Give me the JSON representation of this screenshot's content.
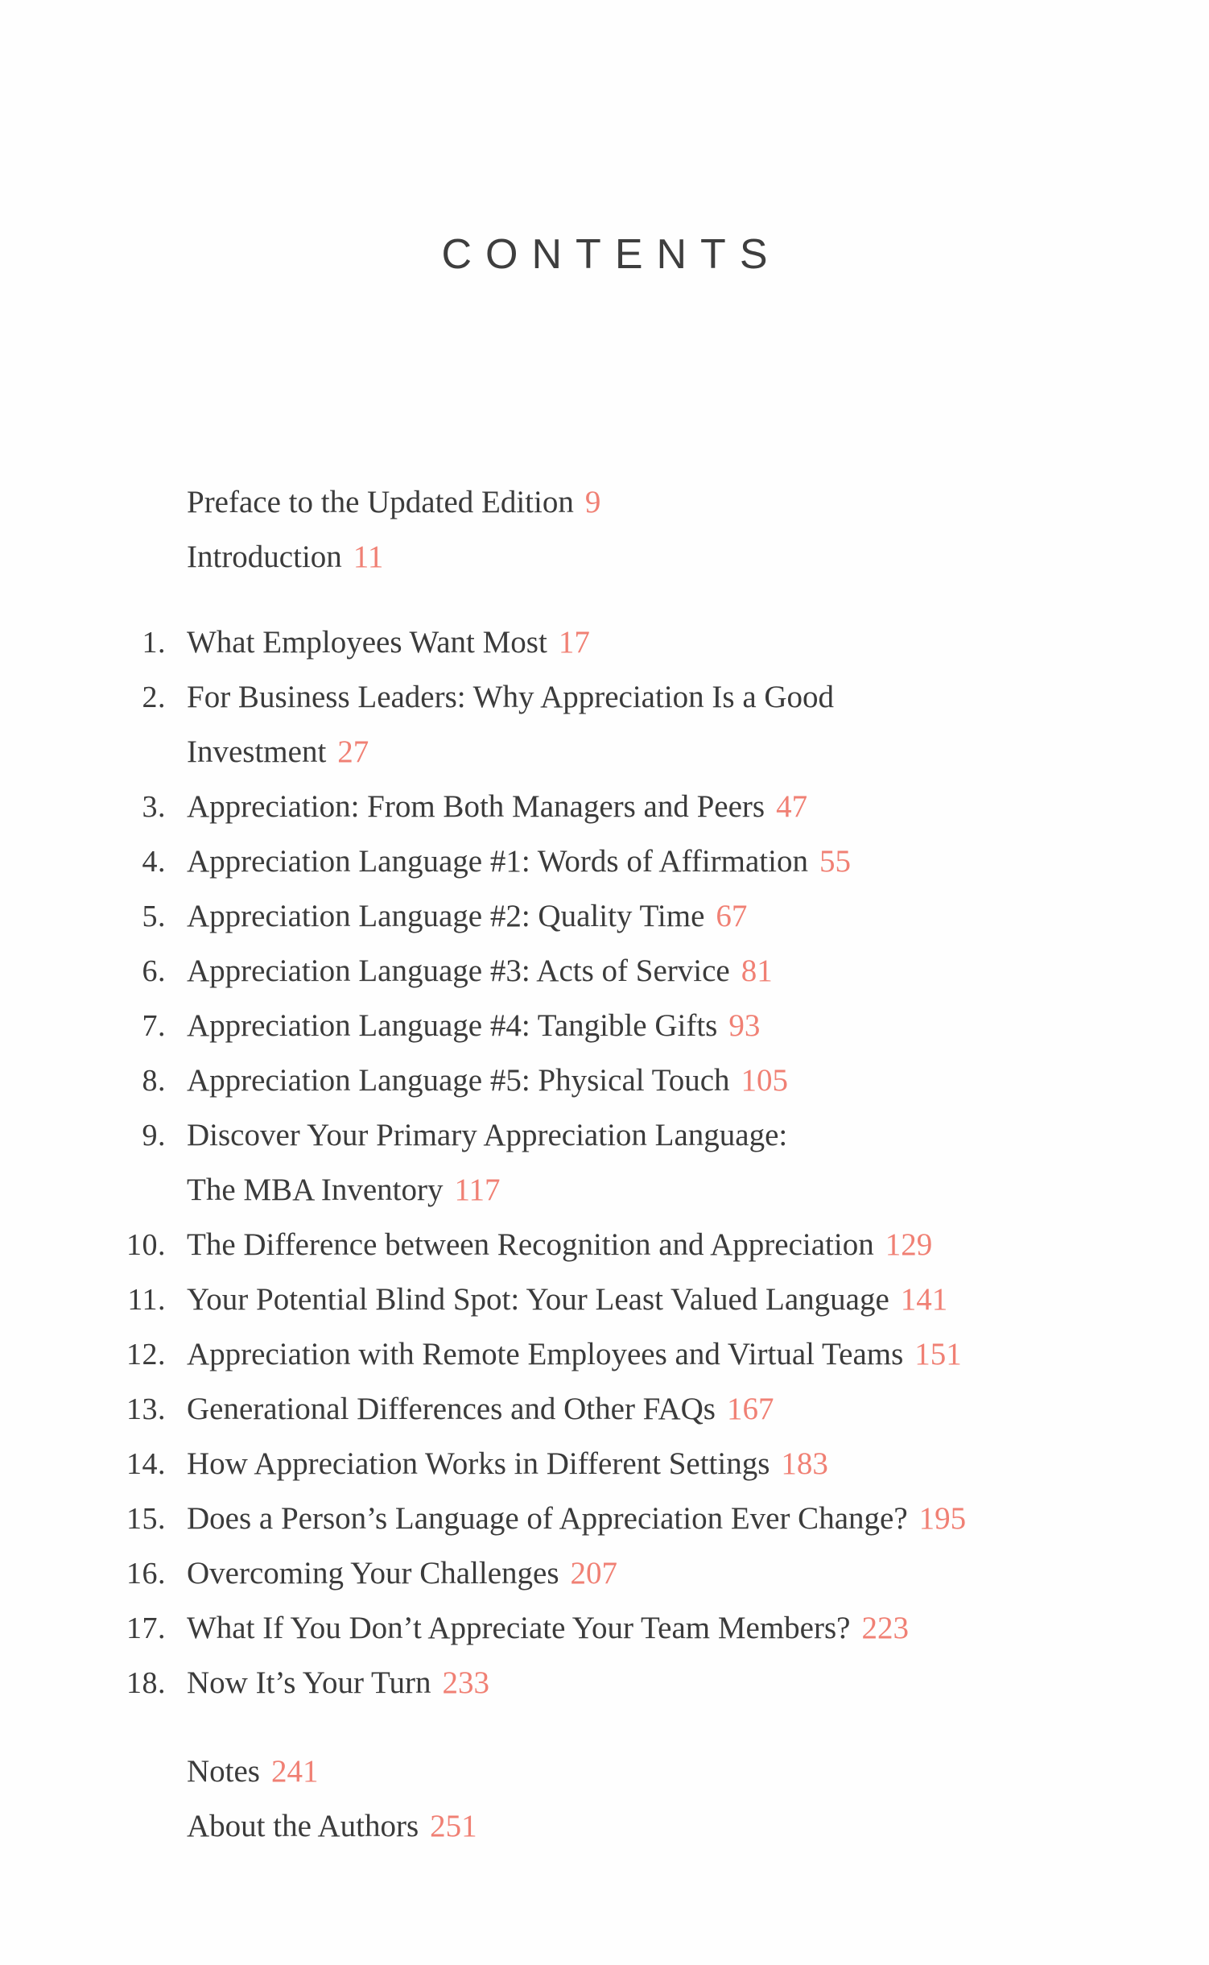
{
  "page": {
    "title": "CONTENTS",
    "accent_color": "#f08074",
    "text_color": "#3b3b3b",
    "background_color": "#fefefe"
  },
  "front_matter": [
    {
      "title": "Preface to the Updated Edition",
      "page": "9"
    },
    {
      "title": "Introduction",
      "page": "11"
    }
  ],
  "chapters": [
    {
      "num": "1.",
      "title": "What Employees Want Most",
      "page": "17"
    },
    {
      "num": "2.",
      "title": "For Business Leaders: Why Appreciation Is a Good",
      "cont_title": "Investment",
      "page": "27"
    },
    {
      "num": "3.",
      "title": "Appreciation: From Both Managers and Peers",
      "page": "47"
    },
    {
      "num": "4.",
      "title": "Appreciation Language #1: Words of Affirmation",
      "page": "55"
    },
    {
      "num": "5.",
      "title": "Appreciation Language #2: Quality Time",
      "page": "67"
    },
    {
      "num": "6.",
      "title": "Appreciation Language #3: Acts of Service",
      "page": "81"
    },
    {
      "num": "7.",
      "title": "Appreciation Language #4: Tangible Gifts",
      "page": "93"
    },
    {
      "num": "8.",
      "title": "Appreciation Language #5: Physical Touch",
      "page": "105"
    },
    {
      "num": "9.",
      "title": "Discover Your Primary Appreciation Language:",
      "cont_title": "The MBA Inventory",
      "page": "117"
    },
    {
      "num": "10.",
      "title": "The Difference between Recognition and Appreciation",
      "page": "129"
    },
    {
      "num": "11.",
      "title": "Your Potential Blind Spot: Your Least Valued Language",
      "page": "141"
    },
    {
      "num": "12.",
      "title": "Appreciation with Remote Employees and Virtual Teams",
      "page": "151"
    },
    {
      "num": "13.",
      "title": "Generational Differences and Other FAQs",
      "page": "167"
    },
    {
      "num": "14.",
      "title": "How Appreciation Works in Different Settings",
      "page": "183"
    },
    {
      "num": "15.",
      "title": "Does a Person’s Language of Appreciation Ever Change?",
      "page": "195"
    },
    {
      "num": "16.",
      "title": "Overcoming Your Challenges",
      "page": "207"
    },
    {
      "num": "17.",
      "title": "What If You Don’t Appreciate Your Team Members?",
      "page": "223"
    },
    {
      "num": "18.",
      "title": "Now It’s Your Turn",
      "page": "233"
    }
  ],
  "back_matter": [
    {
      "title": "Notes",
      "page": "241"
    },
    {
      "title": "About the Authors",
      "page": "251"
    }
  ]
}
